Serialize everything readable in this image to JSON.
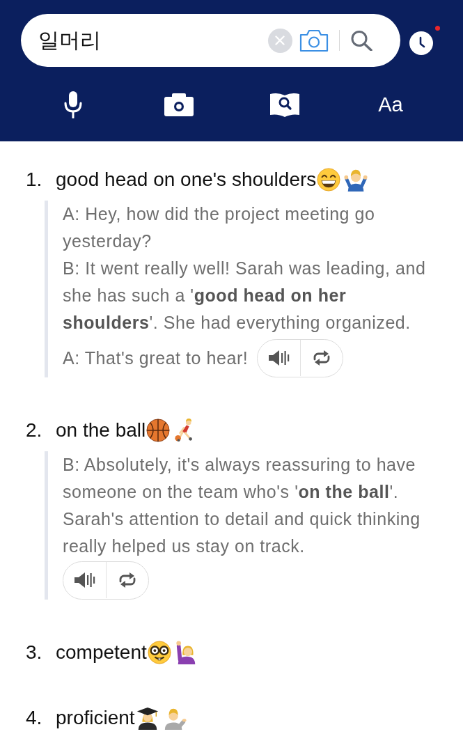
{
  "search": {
    "value": "일머리"
  },
  "history": {
    "has_new": true
  },
  "tools": [
    {
      "kind": "voice"
    },
    {
      "kind": "camera"
    },
    {
      "kind": "book"
    },
    {
      "kind": "text",
      "label": "Aa"
    }
  ],
  "entries": [
    {
      "number": "1.",
      "title": "good head on one's shoulders",
      "dialogue": [
        "A: Hey, how did the project meeting go yesterday?",
        "B: It went really well! Sarah was leading, and she has such a '**good head on her shoulders**'. She had everything organized.",
        "A: That's great to hear!"
      ]
    },
    {
      "number": "2.",
      "title": "on the ball",
      "dialogue": [
        "B: Absolutely, it's always reassuring to have someone on the team who's '**on the ball**'. Sarah's attention to detail and quick thinking really helped us stay on track."
      ]
    },
    {
      "number": "3.",
      "title": "competent"
    },
    {
      "number": "4.",
      "title": "proficient"
    }
  ]
}
